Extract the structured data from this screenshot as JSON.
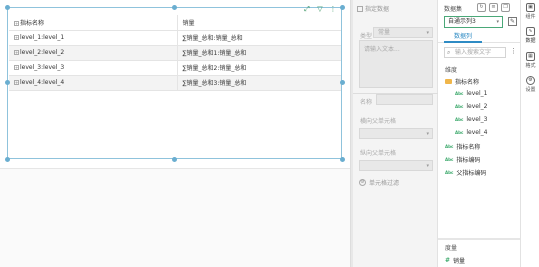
{
  "table": {
    "headers": [
      "指标名称",
      "销量"
    ],
    "rows": [
      {
        "name": "level_1:level_1",
        "value": "∑销量_总和:销量_总和"
      },
      {
        "name": "level_2:level_2",
        "value": "∑销量_总和1:销量_总和"
      },
      {
        "name": "level_3:level_3",
        "value": "∑销量_总和2:销量_总和"
      },
      {
        "name": "level_4:level_4",
        "value": "∑销量_总和3:销量_总和"
      }
    ]
  },
  "props": {
    "title": "指定数据",
    "type_label": "类型",
    "type_value": "常量",
    "text_placeholder": "请输入文本...",
    "name_label": "名称",
    "h_parent_label": "横向父单元格",
    "v_parent_label": "纵向父单元格",
    "filter_label": "单元格过滤"
  },
  "datapanel": {
    "title": "数据集",
    "dataset": "自通示列3",
    "tab": "数据列",
    "search_placeholder": "输入搜索文字",
    "dimension_label": "维度",
    "folder": "指标名称",
    "levels": [
      "level_1",
      "level_2",
      "level_3",
      "level_4"
    ],
    "fields": [
      "指标名称",
      "指标编码",
      "父指标编码"
    ],
    "measure_label": "度量",
    "measure": "销量"
  },
  "iconbar": [
    {
      "label": "组件",
      "icon": "component-icon"
    },
    {
      "label": "数据",
      "icon": "data-icon"
    },
    {
      "label": "格式",
      "icon": "format-icon"
    },
    {
      "label": "设置",
      "icon": "settings-icon"
    }
  ],
  "colors": {
    "accent": "#2e8bc4",
    "green": "#3aa86a",
    "selection": "#6aaed0"
  }
}
